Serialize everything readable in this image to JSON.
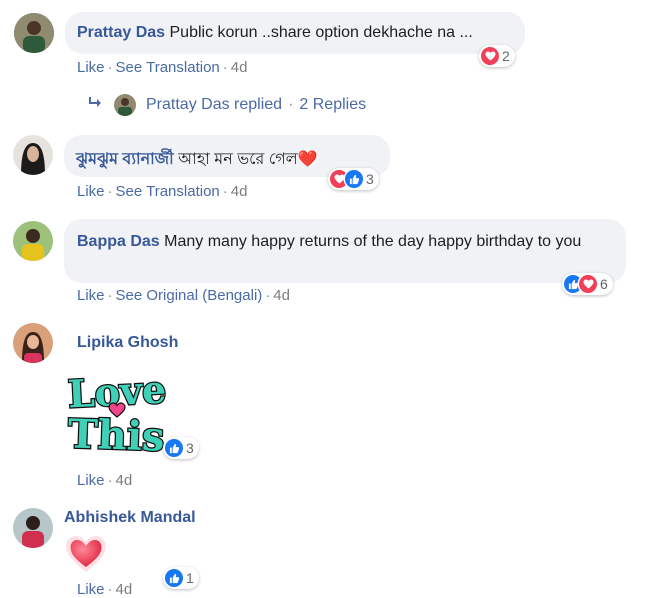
{
  "comments": [
    {
      "name": "Prattay Das",
      "text": "Public korun ..share option dekhache na ...",
      "actions": [
        "Like",
        "See Translation",
        "4d"
      ],
      "reaction_count": "2"
    },
    {
      "name": "ঝুমঝুম ব্যানার্জী",
      "text": "আহা মন ভরে গেল❤️",
      "actions": [
        "Like",
        "See Translation",
        "4d"
      ],
      "reaction_count": "3"
    },
    {
      "name": "Bappa Das",
      "text": "Many many happy returns of the day happy birthday to you",
      "actions": [
        "Like",
        "See Original (Bengali)",
        "4d"
      ],
      "reaction_count": "6"
    },
    {
      "name": "Lipika Ghosh",
      "sticker_text": [
        "Love",
        "This"
      ],
      "actions": [
        "Like",
        "4d"
      ],
      "reaction_count": "3"
    },
    {
      "name": "Abhishek Mandal",
      "sticker": "heart",
      "actions": [
        "Like",
        "4d"
      ],
      "reaction_count": "1"
    }
  ],
  "reply_link": {
    "text": "Prattay Das replied",
    "sep": "·",
    "count_text": "2 Replies"
  },
  "colors": {
    "link": "#385898",
    "heart": "#f33e58",
    "like": "#1877f2",
    "bubble": "#f0f2f5",
    "sticker_teal": "#3fd1b8"
  }
}
